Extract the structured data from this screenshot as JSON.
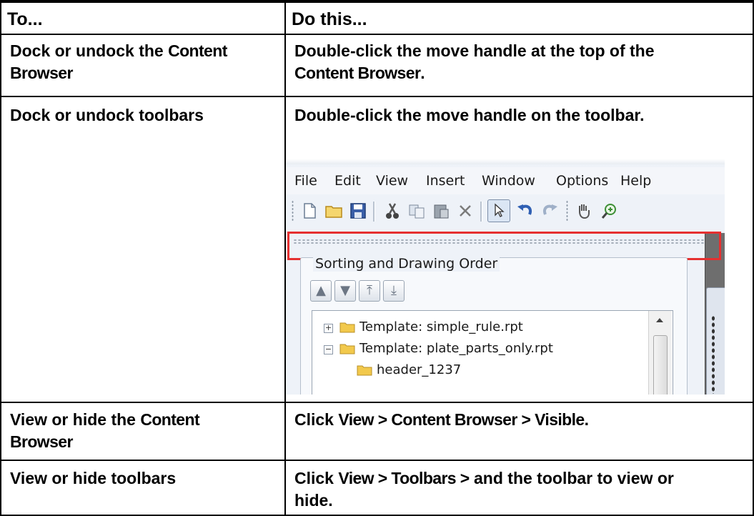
{
  "table": {
    "header": {
      "col1": "To...",
      "col2": "Do this..."
    },
    "rows": [
      {
        "to_a": "Dock or undock the ",
        "to_term": "Content",
        "to_b": "Browser",
        "do_a": "Double-click the move handle at the top of the",
        "do_term": "Content Browser",
        "do_b": "."
      },
      {
        "to": "Dock or undock toolbars",
        "do": "Double-click the move handle on the toolbar."
      },
      {
        "to_a": "View or hide the ",
        "to_term": "Content",
        "to_b": "Browser",
        "do_a": "Click ",
        "do_term": "View > Content Browser > Visible",
        "do_b": "."
      },
      {
        "to": "View or hide toolbars",
        "do_a": "Click ",
        "do_term": "View > Toolbars >",
        "do_b": " and the toolbar to view or",
        "do_c": "hide."
      }
    ]
  },
  "screenshot": {
    "menu": [
      "File",
      "Edit",
      "View",
      "Insert",
      "Window",
      "Options",
      "Help"
    ],
    "panel_title": "Sorting and Drawing Order",
    "tree_items": [
      {
        "label": "Template: simple_rule.rpt",
        "expander": "+"
      },
      {
        "label": "Template: plate_parts_only.rpt",
        "expander": "−"
      },
      {
        "label": "header_1237"
      }
    ],
    "colors": {
      "highlight_box": "#e53030",
      "folder": "#f2c94c"
    }
  }
}
